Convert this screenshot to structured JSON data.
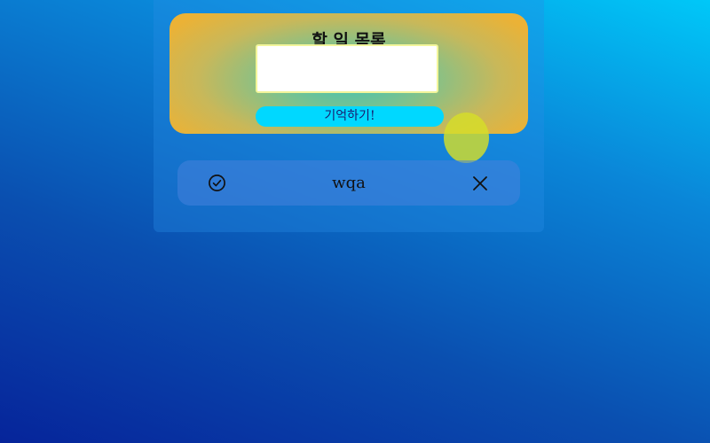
{
  "form": {
    "title": "할 일 목록",
    "input_value": "",
    "submit_label": "기억하기!"
  },
  "todos": [
    {
      "text": "wqa",
      "check_icon": "check-circle-icon",
      "delete_icon": "close-icon"
    }
  ],
  "colors": {
    "button": "#00d8ff",
    "input_border": "#f2f59a",
    "blob": "#d6de28"
  }
}
